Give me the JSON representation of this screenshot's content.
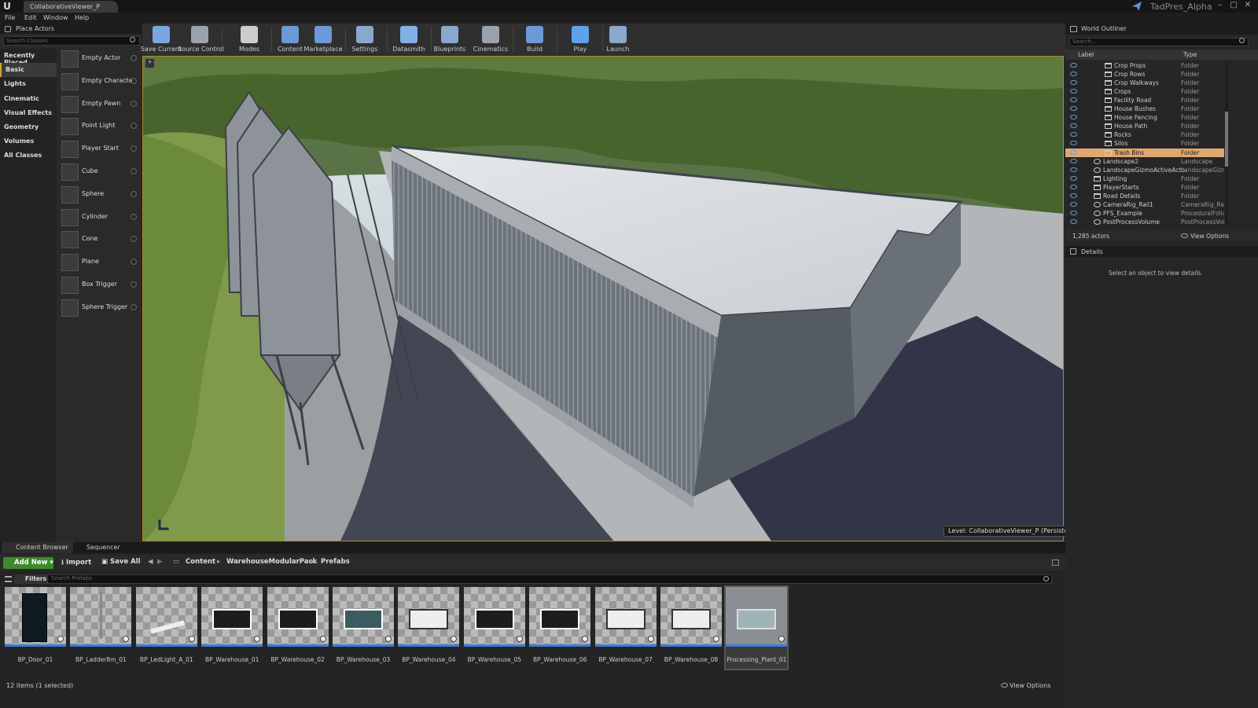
{
  "window": {
    "tab_title": "CollaborativeViewer_P",
    "project_name": "TadPres_Alpha",
    "logo": "U"
  },
  "menu": [
    "File",
    "Edit",
    "Window",
    "Help"
  ],
  "toolbar": [
    {
      "label": "Save Current",
      "icon": "save-icon",
      "color": "#7aa6e0"
    },
    {
      "label": "Source Control",
      "icon": "source-control-icon",
      "color": "#9aa3ad"
    },
    {
      "label": "Modes",
      "icon": "modes-icon",
      "color": "#cccccc"
    },
    {
      "label": "Content",
      "icon": "content-icon",
      "color": "#6b9ad6"
    },
    {
      "label": "Marketplace",
      "icon": "marketplace-icon",
      "color": "#6b9ad6"
    },
    {
      "label": "Settings",
      "icon": "settings-icon",
      "color": "#8aa7cf"
    },
    {
      "label": "Datasmith",
      "icon": "datasmith-icon",
      "color": "#7fb1e8"
    },
    {
      "label": "Blueprints",
      "icon": "blueprints-icon",
      "color": "#8aa7cf"
    },
    {
      "label": "Cinematics",
      "icon": "cinematics-icon",
      "color": "#9aa3ad"
    },
    {
      "label": "Build",
      "icon": "build-icon",
      "color": "#6b9ad6"
    },
    {
      "label": "Play",
      "icon": "play-icon",
      "color": "#5ea2ec"
    },
    {
      "label": "Launch",
      "icon": "launch-icon",
      "color": "#8aa7cf"
    }
  ],
  "place_actors": {
    "title": "Place Actors",
    "search_placeholder": "Search Classes",
    "categories": [
      "Recently Placed",
      "Basic",
      "Lights",
      "Cinematic",
      "Visual Effects",
      "Geometry",
      "Volumes",
      "All Classes"
    ],
    "selected_category": "Basic",
    "items": [
      "Empty Actor",
      "Empty Characte",
      "Empty Pawn",
      "Point Light",
      "Player Start",
      "Cube",
      "Sphere",
      "Cylinder",
      "Cone",
      "Plane",
      "Box Trigger",
      "Sphere Trigger"
    ]
  },
  "viewport": {
    "level_label": "Level:  CollaborativeViewer_P (Persistent)"
  },
  "world_outliner": {
    "title": "World Outliner",
    "search_placeholder": "Search...",
    "col_label": "Label",
    "col_type": "Type",
    "rows": [
      {
        "name": "Crop Props",
        "type": "Folder",
        "indent": 2,
        "folder": true
      },
      {
        "name": "Crop Rows",
        "type": "Folder",
        "indent": 2,
        "folder": true
      },
      {
        "name": "Crop Walkways",
        "type": "Folder",
        "indent": 2,
        "folder": true
      },
      {
        "name": "Crops",
        "type": "Folder",
        "indent": 2,
        "folder": true
      },
      {
        "name": "Facility Road",
        "type": "Folder",
        "indent": 2,
        "folder": true
      },
      {
        "name": "House Bushes",
        "type": "Folder",
        "indent": 2,
        "folder": true
      },
      {
        "name": "House Fencing",
        "type": "Folder",
        "indent": 2,
        "folder": true
      },
      {
        "name": "House Path",
        "type": "Folder",
        "indent": 2,
        "folder": true
      },
      {
        "name": "Rocks",
        "type": "Folder",
        "indent": 2,
        "folder": true
      },
      {
        "name": "Silos",
        "type": "Folder",
        "indent": 2,
        "folder": true
      },
      {
        "name": "Trash Bins",
        "type": "Folder",
        "indent": 2,
        "folder": true,
        "selected": true
      },
      {
        "name": "Landscape2",
        "type": "Landscape",
        "indent": 1,
        "folder": false
      },
      {
        "name": "LandscapeGizmoActiveActo",
        "type": "LandscapeGizm",
        "indent": 1,
        "folder": false
      },
      {
        "name": "Lighting",
        "type": "Folder",
        "indent": 1,
        "folder": true
      },
      {
        "name": "PlayerStarts",
        "type": "Folder",
        "indent": 1,
        "folder": true
      },
      {
        "name": "Road Details",
        "type": "Folder",
        "indent": 1,
        "folder": true
      },
      {
        "name": "CameraRig_Rail1",
        "type": "CameraRig_Rail",
        "indent": 1,
        "folder": false
      },
      {
        "name": "PFS_Example",
        "type": "ProceduralFolia",
        "indent": 1,
        "folder": false
      },
      {
        "name": "PostProcessVolume",
        "type": "PostProcessVol",
        "indent": 1,
        "folder": false
      }
    ],
    "actor_count": "1,285 actors",
    "view_options": "View Options"
  },
  "details": {
    "title": "Details",
    "empty_text": "Select an object to view details."
  },
  "content_browser": {
    "tabs": [
      "Content Browser",
      "Sequencer"
    ],
    "add_new": "Add New",
    "import": "Import",
    "save_all": "Save All",
    "path": [
      "Content",
      "WarehouseModularPack",
      "Prefabs"
    ],
    "filters": "Filters",
    "search_placeholder": "Search Prefabs",
    "assets": [
      {
        "name": "BP_Door_01",
        "kind": "door"
      },
      {
        "name": "BP_Ladder8m_01",
        "kind": "ladder"
      },
      {
        "name": "BP_LedLight_A_01",
        "kind": "light"
      },
      {
        "name": "BP_Warehouse_01",
        "kind": "dark"
      },
      {
        "name": "BP_Warehouse_02",
        "kind": "dark"
      },
      {
        "name": "BP_Warehouse_03",
        "kind": "teal"
      },
      {
        "name": "BP_Warehouse_04",
        "kind": "white"
      },
      {
        "name": "BP_Warehouse_05",
        "kind": "dark"
      },
      {
        "name": "BP_Warehouse_06",
        "kind": "dark"
      },
      {
        "name": "BP_Warehouse_07",
        "kind": "white"
      },
      {
        "name": "BP_Warehouse_08",
        "kind": "white"
      },
      {
        "name": "Processing_Plant_01",
        "kind": "plant",
        "selected": true
      }
    ],
    "status": "12 items (1 selected)",
    "view_options": "View Options"
  }
}
